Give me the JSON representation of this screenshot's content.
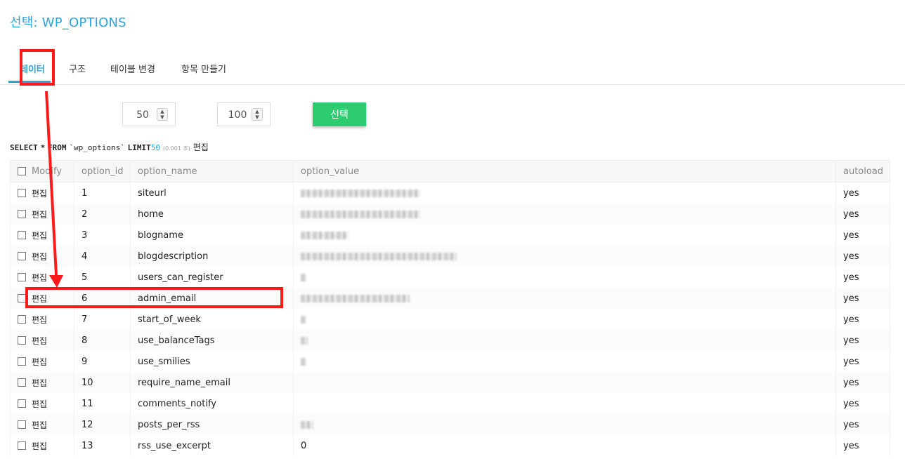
{
  "header": {
    "title": "선택: WP_OPTIONS"
  },
  "tabs": [
    {
      "label": "데이터",
      "active": true
    },
    {
      "label": "구조"
    },
    {
      "label": "테이블 변경"
    },
    {
      "label": "항목 만들기"
    }
  ],
  "controls": {
    "offset_value": "50",
    "limit_value": "100",
    "select_label": "선택"
  },
  "query": {
    "select_kw": "SELECT",
    "star": "*",
    "from_kw": "FROM",
    "table": "`wp_options`",
    "limit_kw": "LIMIT",
    "limit_num": "50",
    "time": "(0.001 초)",
    "edit_link": "편집"
  },
  "table": {
    "columns": [
      "Modify",
      "option_id",
      "option_name",
      "option_value",
      "autoload"
    ],
    "edit_label": "편집",
    "rows": [
      {
        "id": "1",
        "name": "siteurl",
        "value_w": 170,
        "autoload": "yes"
      },
      {
        "id": "2",
        "name": "home",
        "value_w": 170,
        "autoload": "yes"
      },
      {
        "id": "3",
        "name": "blogname",
        "value_w": 68,
        "autoload": "yes"
      },
      {
        "id": "4",
        "name": "blogdescription",
        "value_w": 222,
        "autoload": "yes"
      },
      {
        "id": "5",
        "name": "users_can_register",
        "value_w": 8,
        "autoload": "yes"
      },
      {
        "id": "6",
        "name": "admin_email",
        "value_w": 155,
        "autoload": "yes"
      },
      {
        "id": "7",
        "name": "start_of_week",
        "value_w": 8,
        "autoload": "yes"
      },
      {
        "id": "8",
        "name": "use_balanceTags",
        "value_w": 10,
        "autoload": "yes"
      },
      {
        "id": "9",
        "name": "use_smilies",
        "value_w": 8,
        "autoload": "yes"
      },
      {
        "id": "10",
        "name": "require_name_email",
        "value_w": 0,
        "autoload": "yes"
      },
      {
        "id": "11",
        "name": "comments_notify",
        "value_w": 0,
        "autoload": "yes"
      },
      {
        "id": "12",
        "name": "posts_per_rss",
        "value_w": 18,
        "autoload": "yes"
      },
      {
        "id": "13",
        "name": "rss_use_excerpt",
        "value_text": "0",
        "value_w": 0,
        "autoload": "yes"
      }
    ]
  },
  "annotation_color": "#ff1a1a",
  "accent_color": "#2aa5dc",
  "button_color": "#2ecc71"
}
